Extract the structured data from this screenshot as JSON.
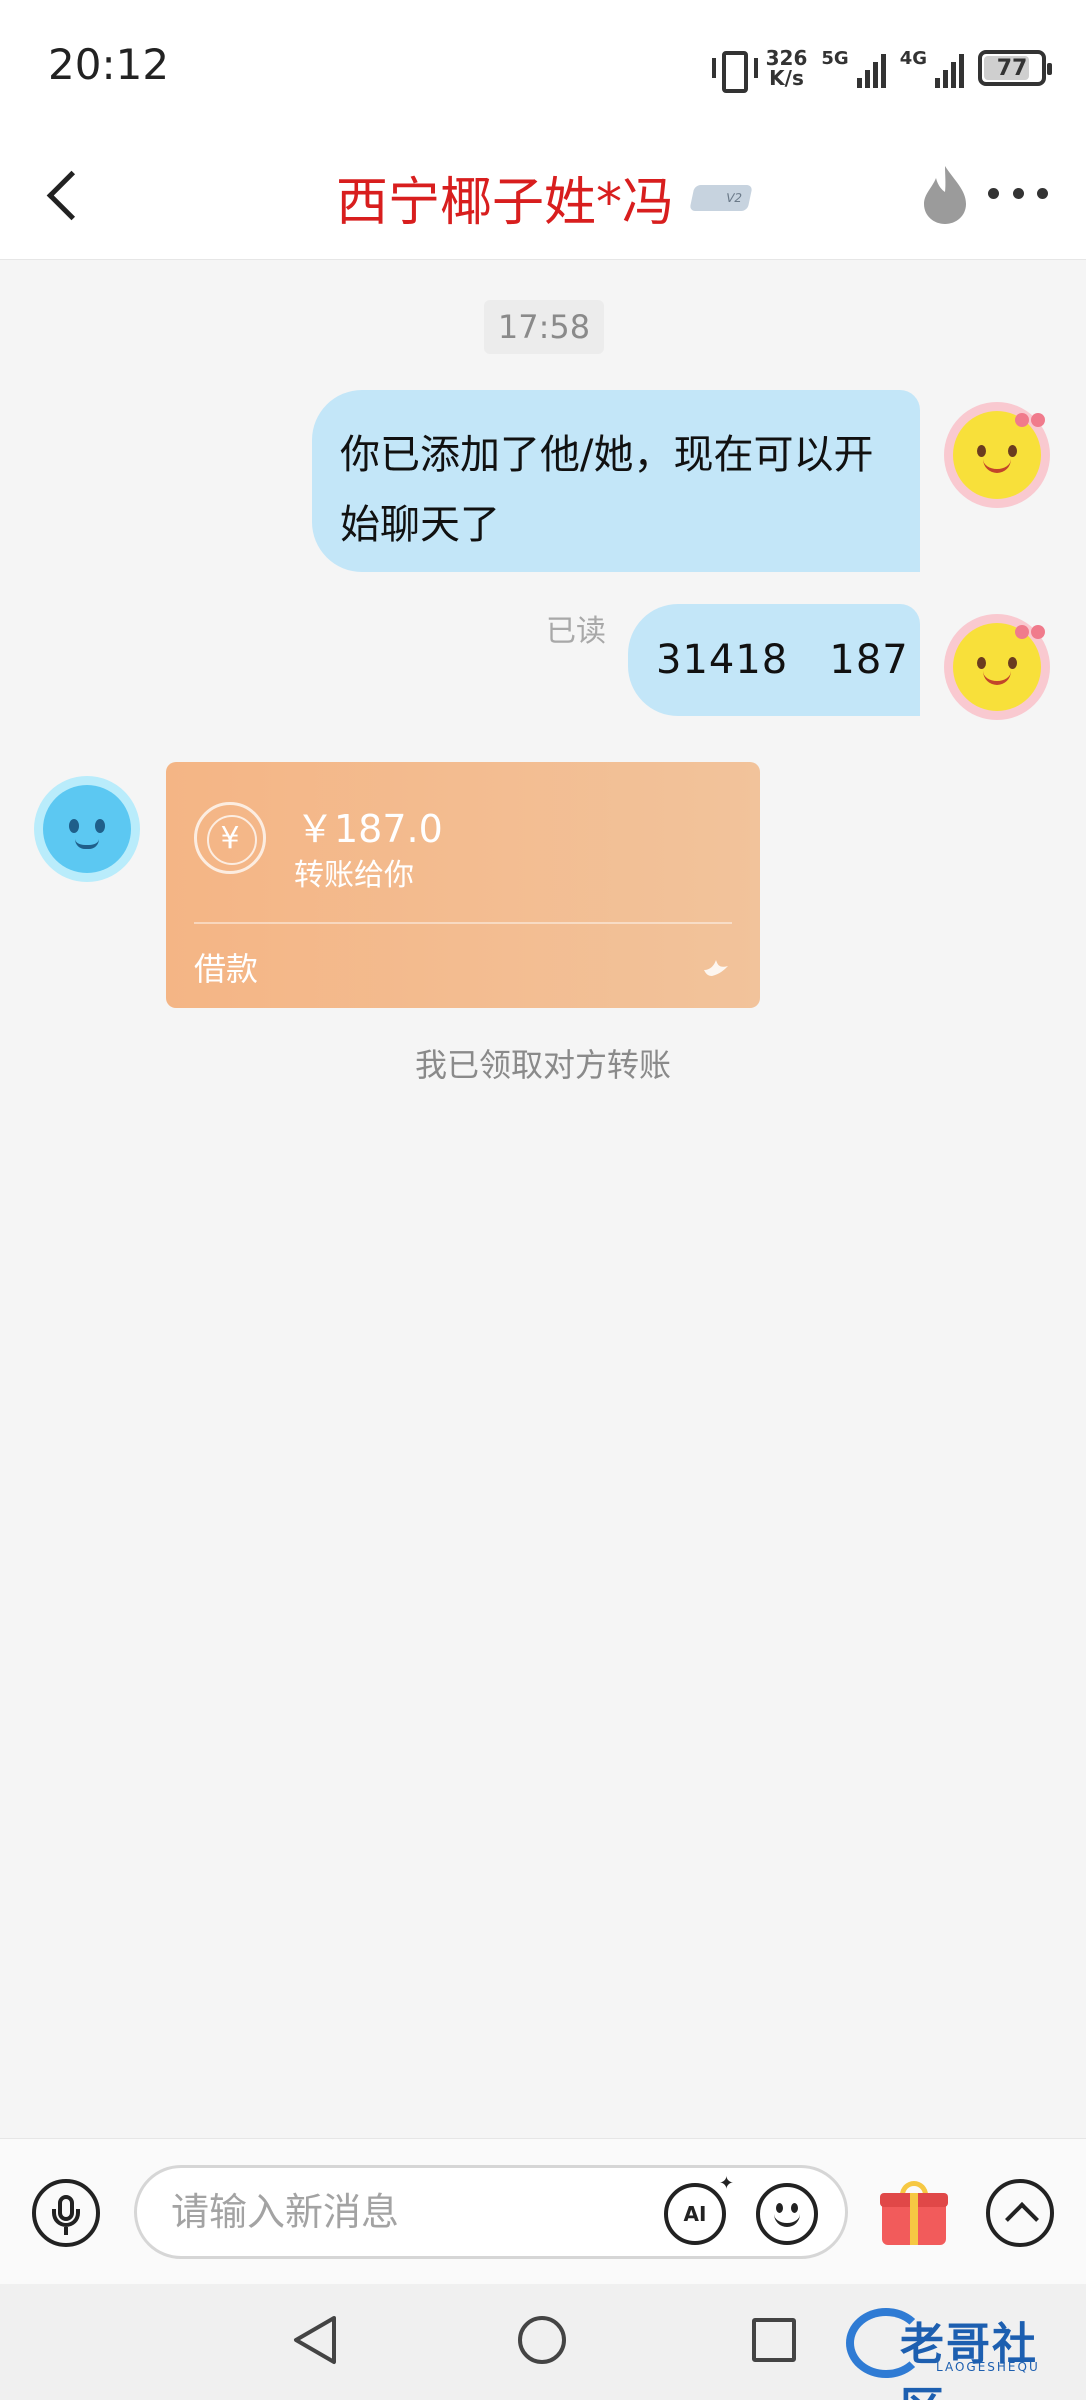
{
  "status_bar": {
    "time": "20:12",
    "net_speed_value": "326",
    "net_speed_unit": "K/s",
    "network_1": "5G",
    "network_2": "4G",
    "battery": "77"
  },
  "header": {
    "title": "西宁椰子姓*冯",
    "title_color": "#d81e1e",
    "badge_text": "V2"
  },
  "chat": {
    "timestamp": "17:58",
    "messages": [
      {
        "sender": "self",
        "text": "你已添加了他/她，现在可以开始聊天了"
      },
      {
        "sender": "self",
        "text": "31418   187",
        "read_label": "已读"
      }
    ],
    "transfer": {
      "amount": "￥187.0",
      "description": "转账给你",
      "note": "借款",
      "currency_symbol": "¥"
    },
    "system_message": "我已领取对方转账"
  },
  "input_bar": {
    "placeholder": "请输入新消息",
    "ai_label": "AI"
  },
  "watermark": {
    "text": "老哥社区",
    "sub": "LAOGESHEQU"
  },
  "colors": {
    "self_bubble": "#c3e6f8",
    "transfer_card": "#f4b585",
    "background": "#f5f5f5"
  }
}
